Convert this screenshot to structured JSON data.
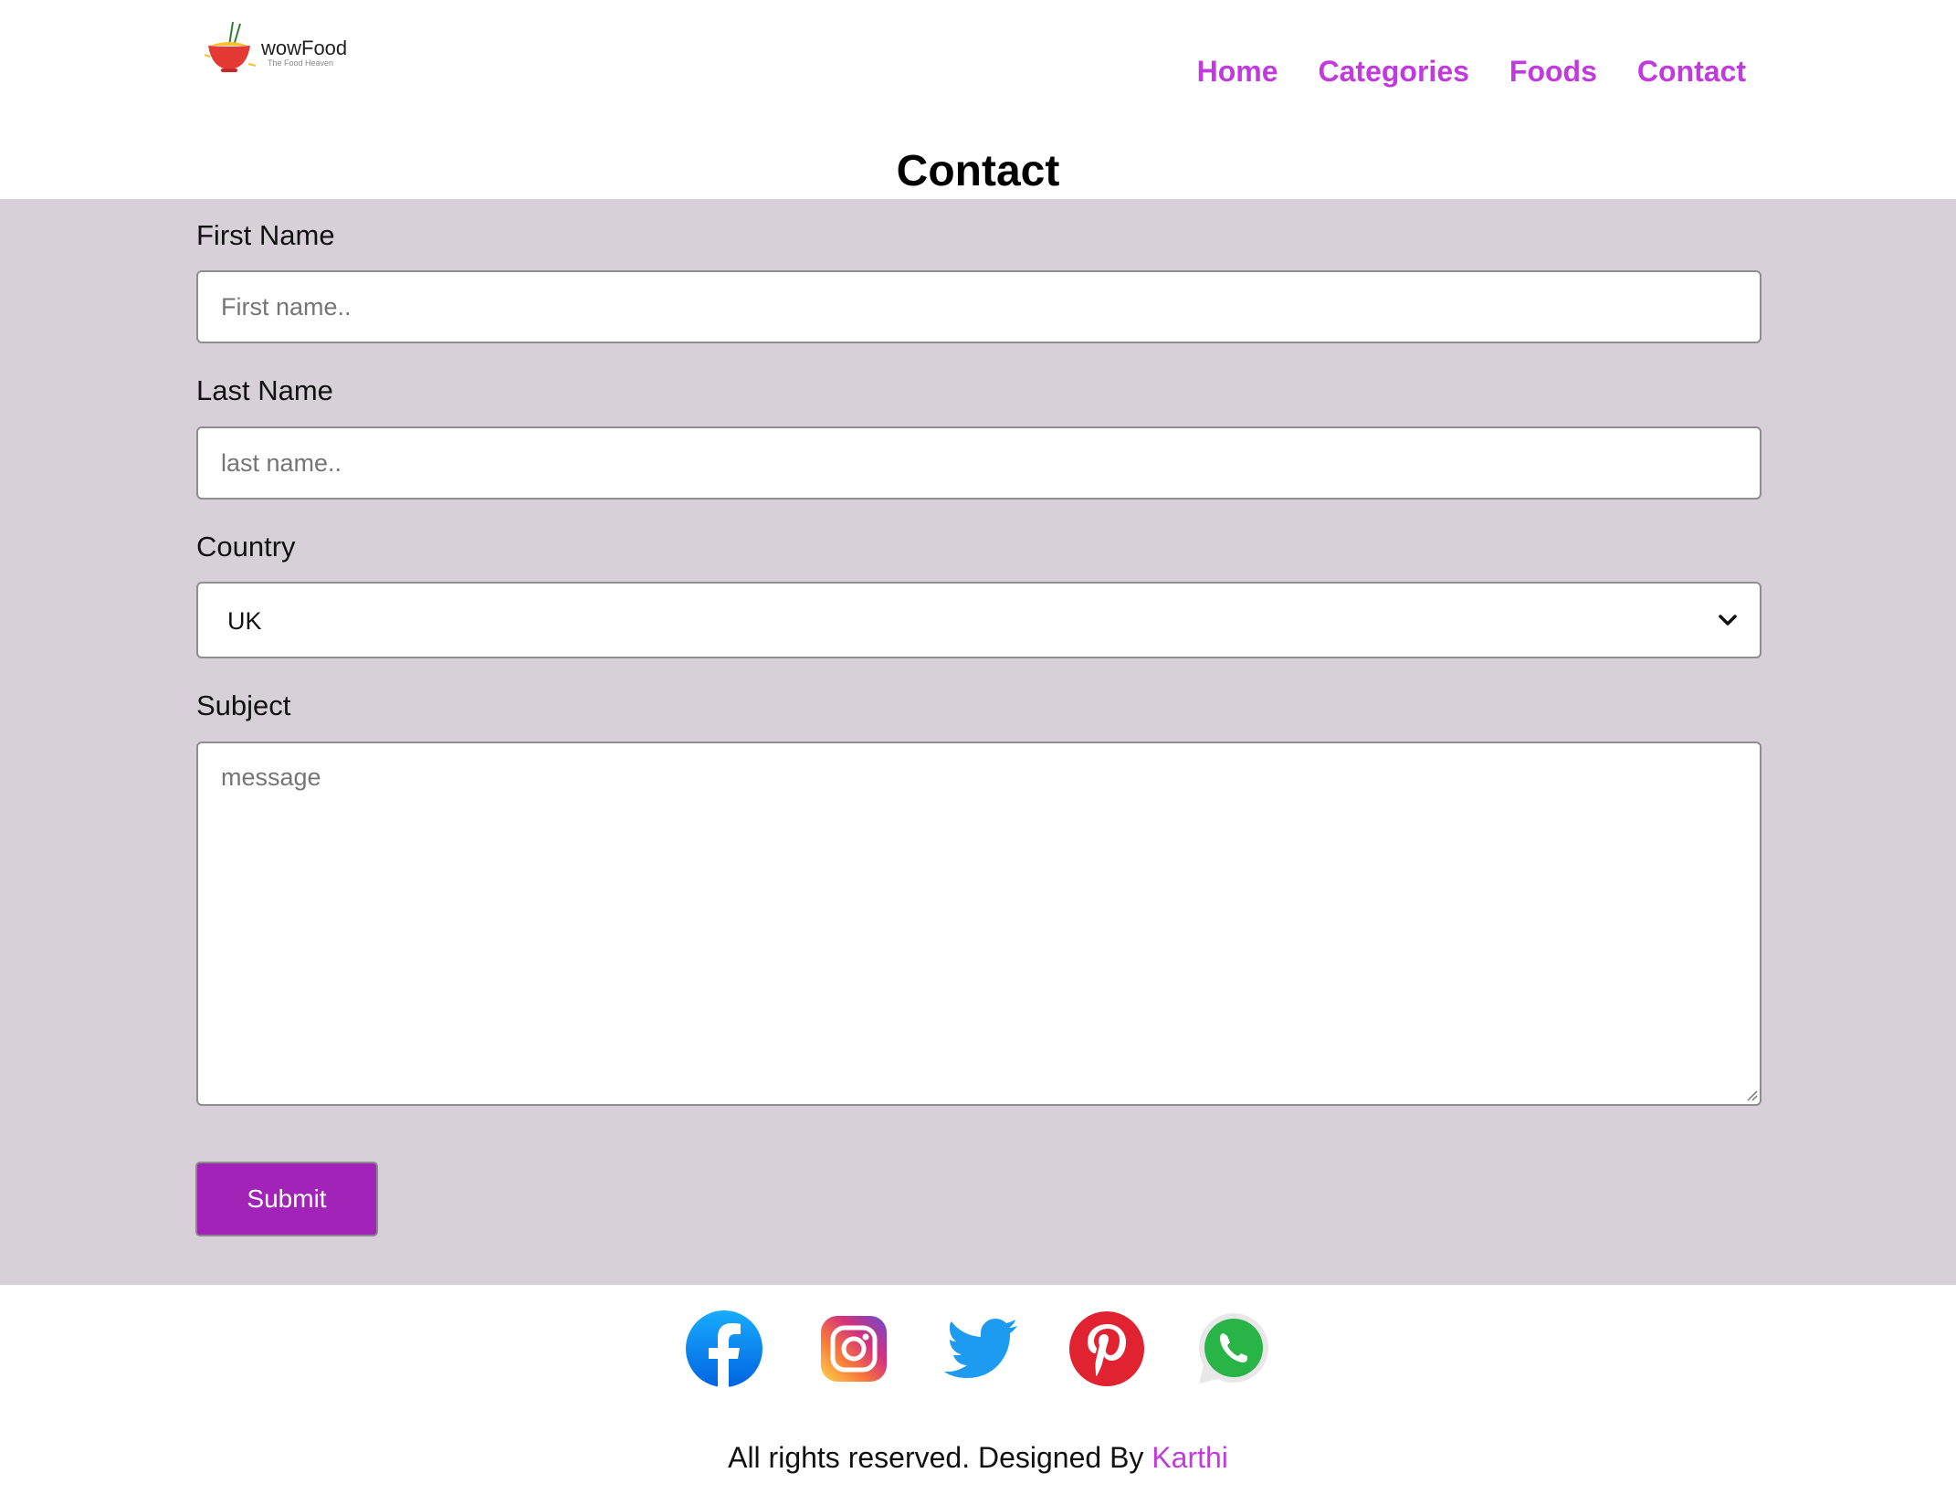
{
  "brand": {
    "name": "wowFood",
    "tagline": "The Food Heaven"
  },
  "nav": {
    "items": [
      {
        "label": "Home"
      },
      {
        "label": "Categories"
      },
      {
        "label": "Foods"
      },
      {
        "label": "Contact"
      }
    ]
  },
  "page": {
    "title": "Contact"
  },
  "form": {
    "first_name": {
      "label": "First Name",
      "placeholder": "First name..",
      "value": ""
    },
    "last_name": {
      "label": "Last Name",
      "placeholder": "last name..",
      "value": ""
    },
    "country": {
      "label": "Country",
      "selected": "UK"
    },
    "subject": {
      "label": "Subject",
      "placeholder": "message",
      "value": ""
    },
    "submit_label": "Submit"
  },
  "footer": {
    "social": [
      "facebook-icon",
      "instagram-icon",
      "twitter-icon",
      "pinterest-icon",
      "whatsapp-icon"
    ],
    "text": "All rights reserved. Designed By ",
    "author": "Karthi"
  },
  "colors": {
    "accent": "#c13bdc",
    "button": "#a123b8",
    "form_background": "#d8d0d9"
  }
}
